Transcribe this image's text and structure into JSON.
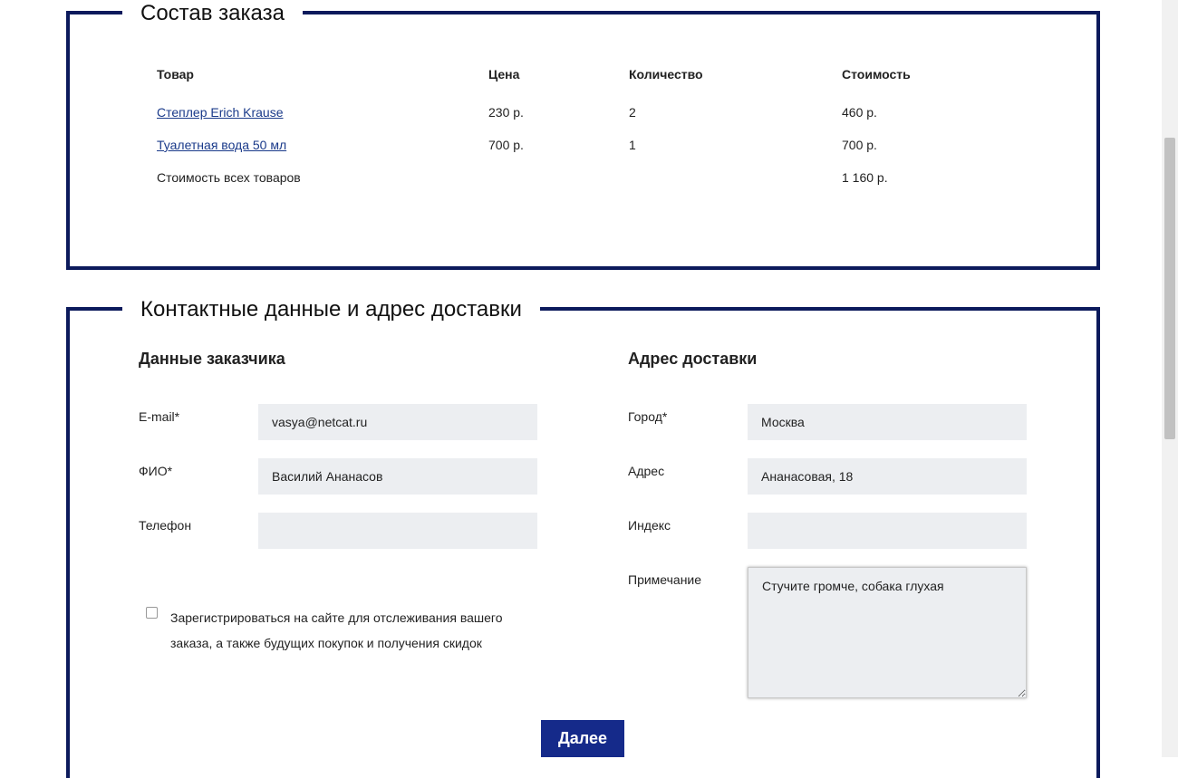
{
  "order": {
    "title": "Состав заказа",
    "headers": [
      "Товар",
      "Цена",
      "Количество",
      "Стоимость"
    ],
    "rows": [
      {
        "product": "Степлер Erich Krause",
        "price": "230 р.",
        "qty": "2",
        "total": "460 р."
      },
      {
        "product": "Туалетная вода 50 мл",
        "price": "700 р.",
        "qty": "1",
        "total": "700 р."
      }
    ],
    "sum_label": "Стоимость всех товаров",
    "sum_value": "1 160 р."
  },
  "contact": {
    "title": "Контактные данные и адрес доставки",
    "customer": {
      "heading": "Данные заказчика",
      "email_label": "E-mail*",
      "email_value": "vasya@netcat.ru",
      "name_label": "ФИО*",
      "name_value": "Василий Ананасов",
      "phone_label": "Телефон",
      "phone_value": ""
    },
    "delivery": {
      "heading": "Адрес доставки",
      "city_label": "Город*",
      "city_value": "Москва",
      "address_label": "Адрес",
      "address_value": "Ананасовая, 18",
      "zip_label": "Индекс",
      "zip_value": "",
      "note_label": "Примечание",
      "note_value": "Стучите громче, собака глухая"
    },
    "register_text": "Зарегистрироваться на сайте для отслеживания вашего заказа, а также будущих покупок и получения скидок",
    "register_checked": false,
    "submit_label": "Далее"
  },
  "colors": {
    "frame": "#0c1a5c",
    "button": "#152a8a",
    "input_bg": "#eceef1",
    "link": "#1a3a8a"
  }
}
